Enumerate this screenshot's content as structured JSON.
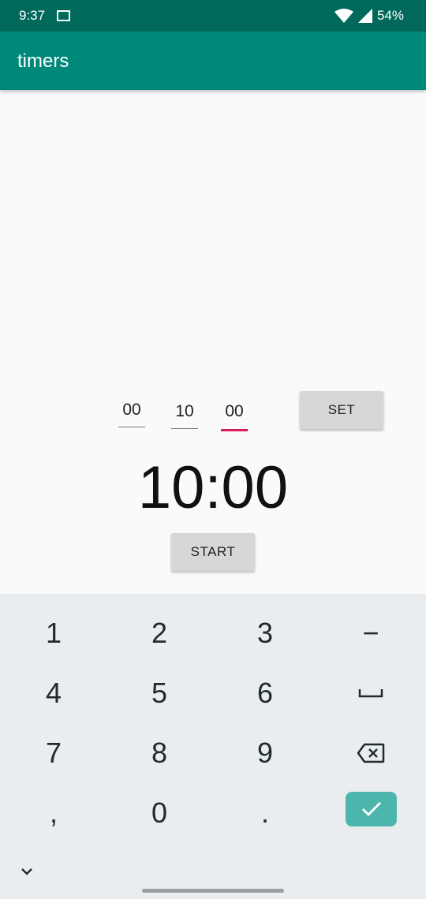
{
  "status_bar": {
    "time": "9:37",
    "battery": "54%",
    "icons": [
      "image-notification-icon",
      "wifi-icon",
      "cell-signal-icon"
    ]
  },
  "app_bar": {
    "title": "timers"
  },
  "timer_input": {
    "hours": "00",
    "minutes": "10",
    "seconds": "00",
    "focused_field": "seconds",
    "focus_color": "#d81b60"
  },
  "set_label": "SET",
  "timer_display": "10:00",
  "start_label": "START",
  "keyboard": {
    "keys": [
      "1",
      "2",
      "3",
      "−",
      "4",
      "5",
      "6",
      "space",
      "7",
      "8",
      "9",
      "backspace",
      ",",
      "0",
      ".",
      "enter"
    ],
    "enter_color": "#4db6ac"
  },
  "colors": {
    "status_bar": "#00695c",
    "app_bar": "#00897b",
    "keyboard_bg": "#e9edf0"
  }
}
